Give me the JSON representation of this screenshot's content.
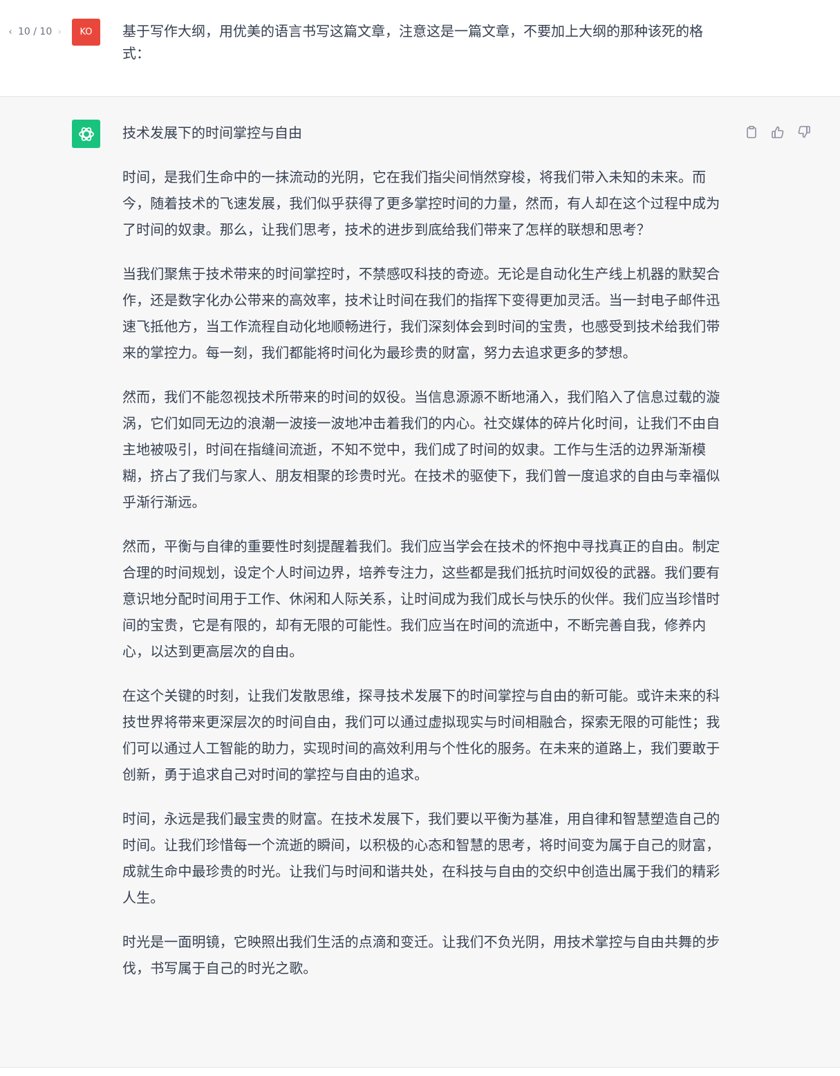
{
  "user_message": {
    "pager": {
      "text": "10 / 10",
      "prev_icon": "chevron-left-icon",
      "next_icon": "chevron-right-icon"
    },
    "avatar_initials": "KO",
    "avatar_color": "#e9473b",
    "text": "基于写作大纲，用优美的语言书写这篇文章，注意这是一篇文章，不要加上大纲的那种该死的格式："
  },
  "assistant_message": {
    "avatar_icon": "openai-logo-icon",
    "avatar_color": "#19c37d",
    "actions": [
      {
        "name": "copy",
        "icon": "clipboard-icon"
      },
      {
        "name": "thumbs-up",
        "icon": "thumbs-up-icon"
      },
      {
        "name": "thumbs-down",
        "icon": "thumbs-down-icon"
      }
    ],
    "title": "技术发展下的时间掌控与自由",
    "paragraphs": [
      "时间，是我们生命中的一抹流动的光阴，它在我们指尖间悄然穿梭，将我们带入未知的未来。而今，随着技术的飞速发展，我们似乎获得了更多掌控时间的力量，然而，有人却在这个过程中成为了时间的奴隶。那么，让我们思考，技术的进步到底给我们带来了怎样的联想和思考？",
      "当我们聚焦于技术带来的时间掌控时，不禁感叹科技的奇迹。无论是自动化生产线上机器的默契合作，还是数字化办公带来的高效率，技术让时间在我们的指挥下变得更加灵活。当一封电子邮件迅速飞抵他方，当工作流程自动化地顺畅进行，我们深刻体会到时间的宝贵，也感受到技术给我们带来的掌控力。每一刻，我们都能将时间化为最珍贵的财富，努力去追求更多的梦想。",
      "然而，我们不能忽视技术所带来的时间的奴役。当信息源源不断地涌入，我们陷入了信息过载的漩涡，它们如同无边的浪潮一波接一波地冲击着我们的内心。社交媒体的碎片化时间，让我们不由自主地被吸引，时间在指缝间流逝，不知不觉中，我们成了时间的奴隶。工作与生活的边界渐渐模糊，挤占了我们与家人、朋友相聚的珍贵时光。在技术的驱使下，我们曾一度追求的自由与幸福似乎渐行渐远。",
      "然而，平衡与自律的重要性时刻提醒着我们。我们应当学会在技术的怀抱中寻找真正的自由。制定合理的时间规划，设定个人时间边界，培养专注力，这些都是我们抵抗时间奴役的武器。我们要有意识地分配时间用于工作、休闲和人际关系，让时间成为我们成长与快乐的伙伴。我们应当珍惜时间的宝贵，它是有限的，却有无限的可能性。我们应当在时间的流逝中，不断完善自我，修养内心，以达到更高层次的自由。",
      "在这个关键的时刻，让我们发散思维，探寻技术发展下的时间掌控与自由的新可能。或许未来的科技世界将带来更深层次的时间自由，我们可以通过虚拟现实与时间相融合，探索无限的可能性；我们可以通过人工智能的助力，实现时间的高效利用与个性化的服务。在未来的道路上，我们要敢于创新，勇于追求自己对时间的掌控与自由的追求。",
      "时间，永远是我们最宝贵的财富。在技术发展下，我们要以平衡为基准，用自律和智慧塑造自己的时间。让我们珍惜每一个流逝的瞬间，以积极的心态和智慧的思考，将时间变为属于自己的财富，成就生命中最珍贵的时光。让我们与时间和谐共处，在科技与自由的交织中创造出属于我们的精彩人生。",
      "时光是一面明镜，它映照出我们生活的点滴和变迁。让我们不负光阴，用技术掌控与自由共舞的步伐，书写属于自己的时光之歌。"
    ]
  }
}
